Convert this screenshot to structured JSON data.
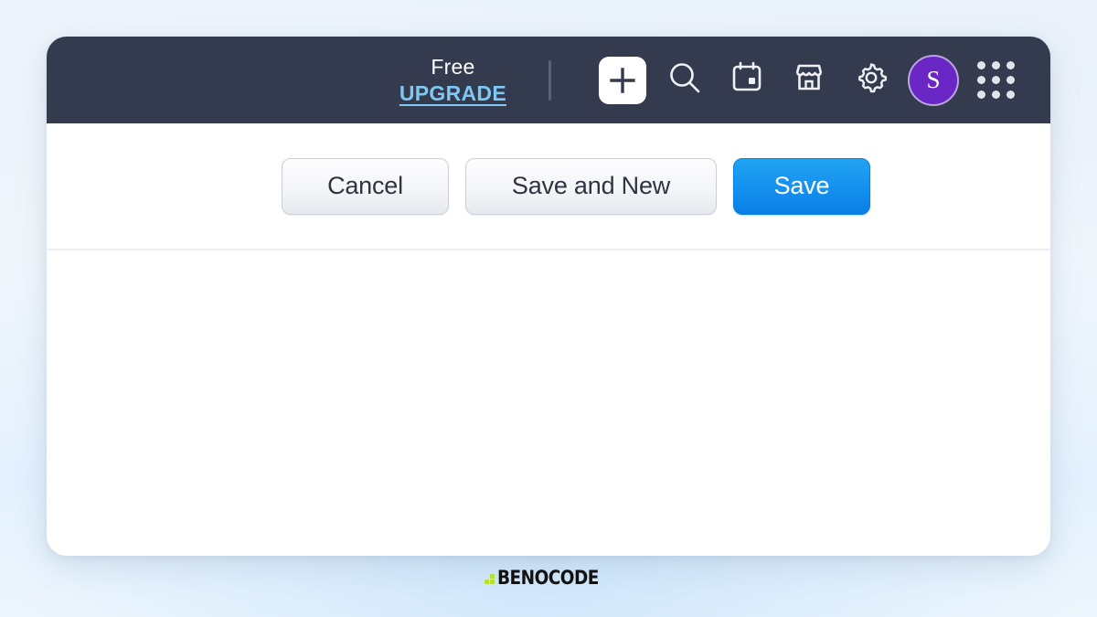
{
  "window": {
    "title": "CRM App Window"
  },
  "topbar": {
    "plan": {
      "label": "Free",
      "upgrade_label": "UPGRADE"
    },
    "icons": [
      {
        "name": "add-icon",
        "glyph": "plus"
      },
      {
        "name": "search-icon",
        "glyph": "magnifier"
      },
      {
        "name": "calendar-icon",
        "glyph": "calendar"
      },
      {
        "name": "marketplace-icon",
        "glyph": "storefront"
      },
      {
        "name": "settings-icon",
        "glyph": "gear"
      }
    ],
    "avatar": {
      "initial": "S",
      "color": "#6b27c6"
    },
    "app_grid": {
      "name": "app-grid-icon",
      "dots": 9
    },
    "background_color": "#343b4e"
  },
  "action_bar": {
    "cancel_label": "Cancel",
    "save_and_new_label": "Save and New",
    "save_label": "Save",
    "primary_color": "#1490ef"
  },
  "content": {
    "body_text": ""
  },
  "footer": {
    "brand": "BENOCODE",
    "accent_color": "#b8e027"
  }
}
